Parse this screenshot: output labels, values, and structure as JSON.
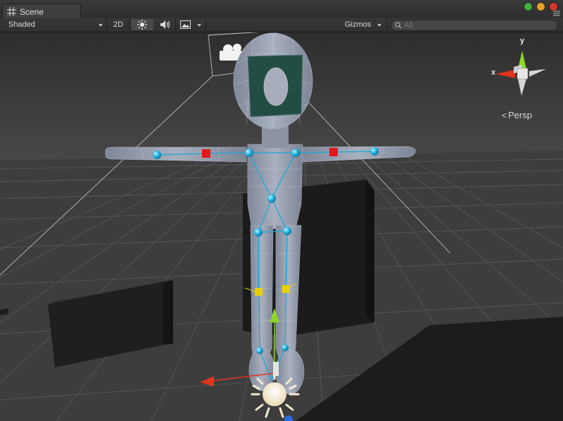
{
  "tab": {
    "title": "Scene"
  },
  "toolbar": {
    "shading_mode": "Shaded",
    "btn_2d": "2D",
    "gizmos_label": "Gizmos",
    "search_placeholder": "All"
  },
  "viewport": {
    "projection_label": "Persp",
    "axis_y": "y",
    "axis_x": "x"
  },
  "colors": {
    "bone_joint": "#25b8e6",
    "effector": "#e01818",
    "foot_effector": "#e6d000",
    "mesh": "#8e96a8",
    "axis_x": "#e0341e",
    "axis_y": "#8ed62a",
    "axis_z": "#2a6ae0"
  }
}
